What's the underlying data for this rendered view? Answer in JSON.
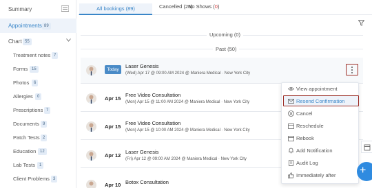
{
  "sidebar": {
    "summary": "Summary",
    "appointments": {
      "label": "Appointments",
      "count": "89"
    },
    "chart": {
      "label": "Chart",
      "count": "55"
    },
    "items": [
      {
        "label": "Treatment notes",
        "count": "7"
      },
      {
        "label": "Forms",
        "count": "15"
      },
      {
        "label": "Photos",
        "count": "6"
      },
      {
        "label": "Allergies",
        "count": "0"
      },
      {
        "label": "Prescriptions",
        "count": "7"
      },
      {
        "label": "Documents",
        "count": "9"
      },
      {
        "label": "Patch Tests",
        "count": "2"
      },
      {
        "label": "Education",
        "count": "12"
      },
      {
        "label": "Lab Tests",
        "count": "1"
      },
      {
        "label": "Client Problems",
        "count": "3"
      }
    ]
  },
  "tabs": {
    "all": "All bookings (89)",
    "cancelled": "Cancelled (26)",
    "noshows_prefix": "No Shows (",
    "noshows_count": "0",
    "noshows_suffix": ")"
  },
  "sections": {
    "upcoming": "Upcoming (0)",
    "past": "Past (50)"
  },
  "rows": [
    {
      "date": "Today",
      "title": "Laser Genesis",
      "sub": "(Wed) Apr 17 @ 09:00 AM 2024 @ Maniera Medical · New York City"
    },
    {
      "date": "Apr 15",
      "title": "Free Video Consultation",
      "sub": "(Mon) Apr 15 @ 11:00 AM 2024 @ Maniera Medical · New York City"
    },
    {
      "date": "Apr 15",
      "title": "Free Video Consultation",
      "sub": "(Mon) Apr 15 @ 10:00 AM 2024 @ Maniera Medical · New York City"
    },
    {
      "date": "Apr 12",
      "title": "Laser Genesis",
      "sub": "(Fri) Apr 12 @ 09:00 AM 2024 @ Maniera Medical · New York City"
    },
    {
      "date": "Apr 10",
      "title": "Botox Consultation",
      "sub": ""
    }
  ],
  "menu": {
    "items": [
      {
        "label": "View appointment",
        "icon": "eye-icon"
      },
      {
        "label": "Resend Confirmation",
        "icon": "envelope-icon"
      },
      {
        "label": "Cancel",
        "icon": "cancel-circle-icon"
      },
      {
        "label": "Reschedule",
        "icon": "calendar-icon"
      },
      {
        "label": "Rebook",
        "icon": "calendar-icon"
      },
      {
        "label": "Add Notification",
        "icon": "bell-icon"
      },
      {
        "label": "Audit Log",
        "icon": "document-icon"
      },
      {
        "label": "Immediately after",
        "icon": "thumbs-up-icon"
      }
    ]
  },
  "fab": {
    "label": "+"
  },
  "colors": {
    "accent": "#3a86c8",
    "highlight_border": "#9b2b23",
    "fab": "#2f8be0",
    "today": "#4a8bc7"
  }
}
